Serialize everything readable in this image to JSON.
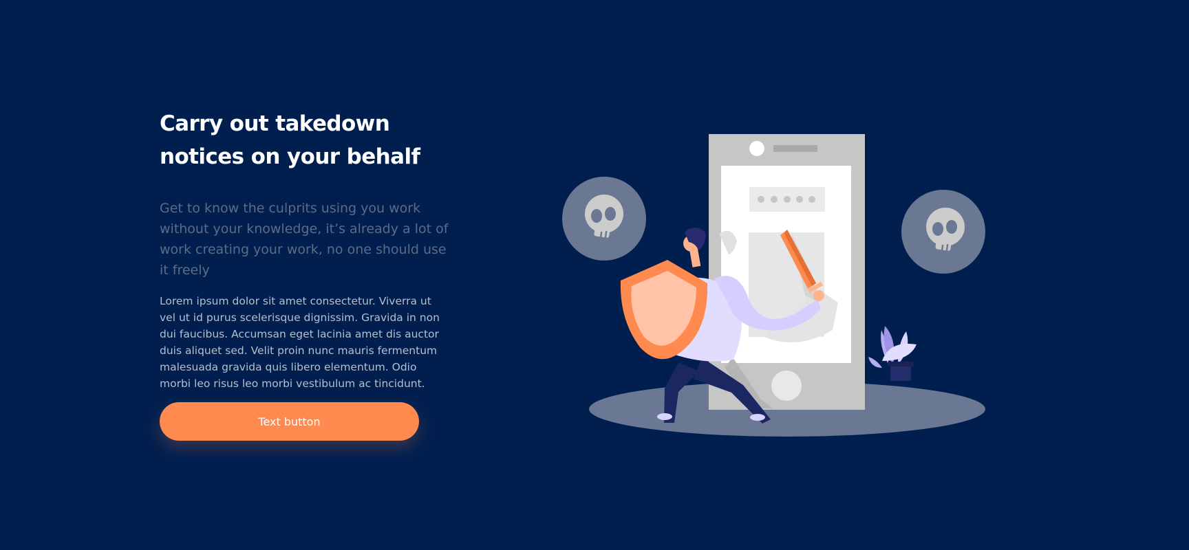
{
  "hero": {
    "title": "Carry out takedown notices on your behalf",
    "subtitle": "Get to know the culprits using you work without your knowledge, it’s already a lot of work creating your work, no one should use it freely",
    "body": "Lorem ipsum dolor sit amet consectetur. Viverra ut vel ut id purus scelerisque dignissim. Gravida in non dui faucibus. Accumsan eget lacinia amet dis auctor duis aliquet sed. Velit proin nunc mauris fermentum malesuada gravida quis libero elementum. Odio morbi leo risus leo morbi vestibulum ac tincidunt.",
    "button_label": "Text button"
  },
  "illustration": {
    "icons": [
      "skull-icon",
      "phone-icon",
      "shield-icon",
      "sword-icon",
      "plant-icon"
    ]
  },
  "colors": {
    "background": "#001f4f",
    "accent": "#ff8a4f",
    "heading": "#ffffff",
    "subtitle": "#5d6b85",
    "body": "#b6bfd0",
    "skull_circle": "#6b7894"
  }
}
